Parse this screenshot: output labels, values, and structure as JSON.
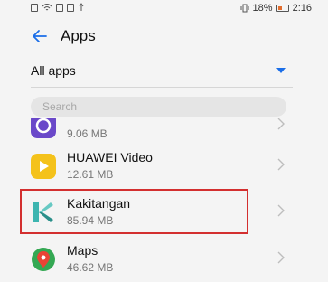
{
  "status_bar": {
    "battery": "18%",
    "time": "2:16"
  },
  "header": {
    "title": "Apps"
  },
  "filter": {
    "selected": "All apps"
  },
  "search": {
    "placeholder": "Search"
  },
  "apps": [
    {
      "name": "",
      "size": "9.06 MB",
      "icon": "partial-app-icon",
      "color": "#6a48c9"
    },
    {
      "name": "HUAWEI Video",
      "size": "12.61 MB",
      "icon": "video-play-icon",
      "color": "#f4c21b"
    },
    {
      "name": "Kakitangan",
      "size": "85.94 MB",
      "icon": "kakitangan-k-icon",
      "color": "#3db5b0"
    },
    {
      "name": "Maps",
      "size": "46.62 MB",
      "icon": "maps-pin-icon",
      "color": "#34a853"
    }
  ],
  "colors": {
    "accent": "#1a6ee8",
    "highlight": "#d32f2f"
  }
}
